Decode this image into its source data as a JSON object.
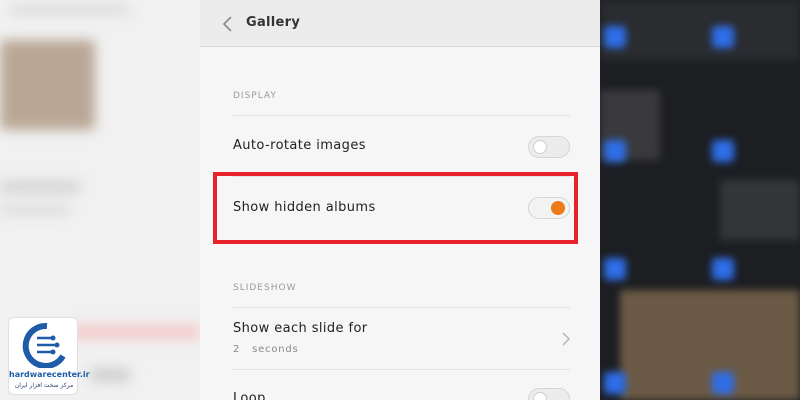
{
  "app_bar": {
    "title": "Gallery",
    "back_icon": "chevron-left-icon"
  },
  "sections": {
    "display": "DISPLAY",
    "slideshow": "SLIDESHOW"
  },
  "settings": {
    "auto_rotate": {
      "label": "Auto-rotate images",
      "enabled": false
    },
    "show_hidden": {
      "label": "Show hidden albums",
      "enabled": true
    },
    "slide_duration": {
      "label": "Show each slide for",
      "value": "2   seconds"
    },
    "loop": {
      "label": "Loop",
      "enabled": false
    }
  },
  "colors": {
    "accent": "#ee7a1a",
    "highlight_border": "#e8212a",
    "logo_blue": "#1f5ca8"
  },
  "watermark": {
    "site": "hardwarecenter.ir",
    "tagline": "مرکز سخت افزار ایران"
  }
}
